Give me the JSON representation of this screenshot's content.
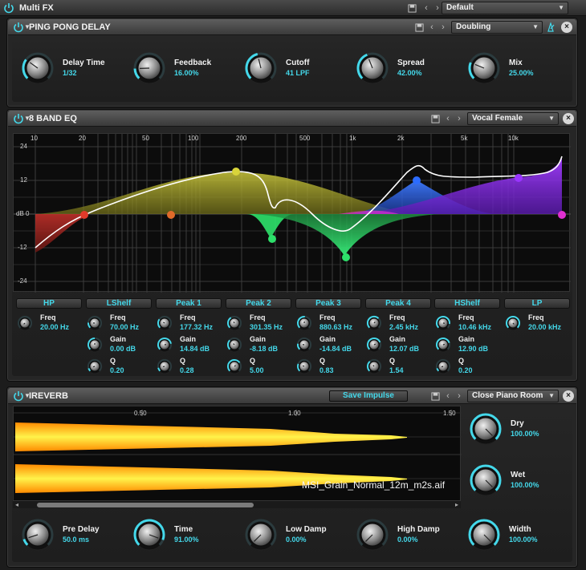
{
  "app": {
    "title": "Multi FX",
    "preset": "Default"
  },
  "colors": {
    "accent": "#44d8ea",
    "band_red": "#c0302a",
    "band_yellow": "#c7c43a",
    "band_green": "#2de06a",
    "band_blue": "#2c6cff",
    "band_purple": "#9a35ff",
    "band_magenta": "#e030d0"
  },
  "delay": {
    "title": "PING PONG DELAY",
    "preset": "Doubling",
    "knobs": [
      {
        "label": "Delay Time",
        "value": "1/32",
        "level": 0.3
      },
      {
        "label": "Feedback",
        "value": "16.00%",
        "level": 0.16
      },
      {
        "label": "Cutoff",
        "value": "41 LPF",
        "level": 0.45
      },
      {
        "label": "Spread",
        "value": "42.00%",
        "level": 0.42
      },
      {
        "label": "Mix",
        "value": "25.00%",
        "level": 0.25
      }
    ]
  },
  "eq": {
    "title": "8 BAND EQ",
    "preset": "Vocal Female",
    "freq_ticks": [
      "10",
      "20",
      "50",
      "100",
      "200",
      "500",
      "1k",
      "2k",
      "5k",
      "10k"
    ],
    "gain_ticks": [
      "24",
      "12",
      "dB 0",
      "-12",
      "-24"
    ],
    "bands": [
      {
        "name": "HP",
        "params": [
          {
            "label": "Freq",
            "value": "20.00 Hz",
            "level": 0.0
          }
        ]
      },
      {
        "name": "LShelf",
        "params": [
          {
            "label": "Freq",
            "value": "70.00 Hz",
            "level": 0.18
          },
          {
            "label": "Gain",
            "value": "0.00 dB",
            "level": 0.5
          },
          {
            "label": "Q",
            "value": "0.20",
            "level": 0.1
          }
        ]
      },
      {
        "name": "Peak 1",
        "params": [
          {
            "label": "Freq",
            "value": "177.32 Hz",
            "level": 0.3
          },
          {
            "label": "Gain",
            "value": "14.84 dB",
            "level": 0.8
          },
          {
            "label": "Q",
            "value": "0.28",
            "level": 0.12
          }
        ]
      },
      {
        "name": "Peak 2",
        "params": [
          {
            "label": "Freq",
            "value": "301.35 Hz",
            "level": 0.38
          },
          {
            "label": "Gain",
            "value": "-8.18 dB",
            "level": 0.33
          },
          {
            "label": "Q",
            "value": "5.00",
            "level": 0.7
          }
        ]
      },
      {
        "name": "Peak 3",
        "params": [
          {
            "label": "Freq",
            "value": "880.63 Hz",
            "level": 0.52
          },
          {
            "label": "Gain",
            "value": "-14.84 dB",
            "level": 0.2
          },
          {
            "label": "Q",
            "value": "0.83",
            "level": 0.25
          }
        ]
      },
      {
        "name": "Peak 4",
        "params": [
          {
            "label": "Freq",
            "value": "2.45 kHz",
            "level": 0.66
          },
          {
            "label": "Gain",
            "value": "12.07 dB",
            "level": 0.75
          },
          {
            "label": "Q",
            "value": "1.54",
            "level": 0.35
          }
        ]
      },
      {
        "name": "HShelf",
        "params": [
          {
            "label": "Freq",
            "value": "10.46 kHz",
            "level": 0.86
          },
          {
            "label": "Gain",
            "value": "12.90 dB",
            "level": 0.77
          },
          {
            "label": "Q",
            "value": "0.20",
            "level": 0.1
          }
        ]
      },
      {
        "name": "LP",
        "params": [
          {
            "label": "Freq",
            "value": "20.00 kHz",
            "level": 1.0
          }
        ]
      }
    ]
  },
  "reverb": {
    "title": "IREVERB",
    "save_label": "Save Impulse",
    "preset": "Close Piano Room",
    "time_ticks": [
      "0.50",
      "1.00",
      "1.50"
    ],
    "filename": "MSI_Grain_Normal_12m_m2s.aif",
    "side_knobs": [
      {
        "label": "Dry",
        "value": "100.00%",
        "level": 1.0
      },
      {
        "label": "Wet",
        "value": "100.00%",
        "level": 1.0
      }
    ],
    "knobs": [
      {
        "label": "Pre Delay",
        "value": "50.0 ms",
        "level": 0.1
      },
      {
        "label": "Time",
        "value": "91.00%",
        "level": 0.91
      },
      {
        "label": "Low Damp",
        "value": "0.00%",
        "level": 0.0
      },
      {
        "label": "High Damp",
        "value": "0.00%",
        "level": 0.0
      },
      {
        "label": "Width",
        "value": "100.00%",
        "level": 1.0
      }
    ]
  }
}
